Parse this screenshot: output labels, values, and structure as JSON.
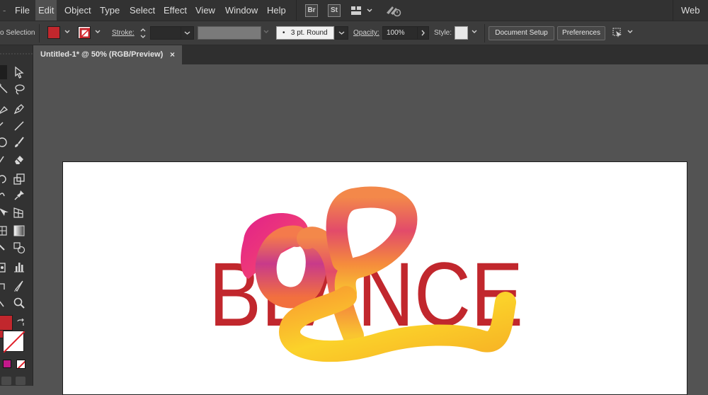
{
  "menubar": {
    "items": [
      "File",
      "Edit",
      "Object",
      "Type",
      "Select",
      "Effect",
      "View",
      "Window",
      "Help"
    ],
    "active": "Edit",
    "bridge_icon": "Br",
    "stock_icon": "St",
    "workspace": "Web"
  },
  "controlbar": {
    "selection_label": "o Selection",
    "stroke_label": "Stroke:",
    "brush_value": "3 pt. Round",
    "opacity_label": "Opacity:",
    "opacity_value": "100%",
    "style_label": "Style:",
    "document_setup": "Document Setup",
    "preferences": "Preferences"
  },
  "document": {
    "tab_title": "Untitled-1* @ 50% (RGB/Preview)",
    "close_glyph": "×"
  },
  "artwork": {
    "text": "BLANCE",
    "text_color": "#c1272d"
  },
  "colors": {
    "fill": "#c1272d",
    "gradient_magenta": "#e0218a",
    "gradient_orange": "#f2764a",
    "gradient_yellow": "#fbd22a"
  }
}
